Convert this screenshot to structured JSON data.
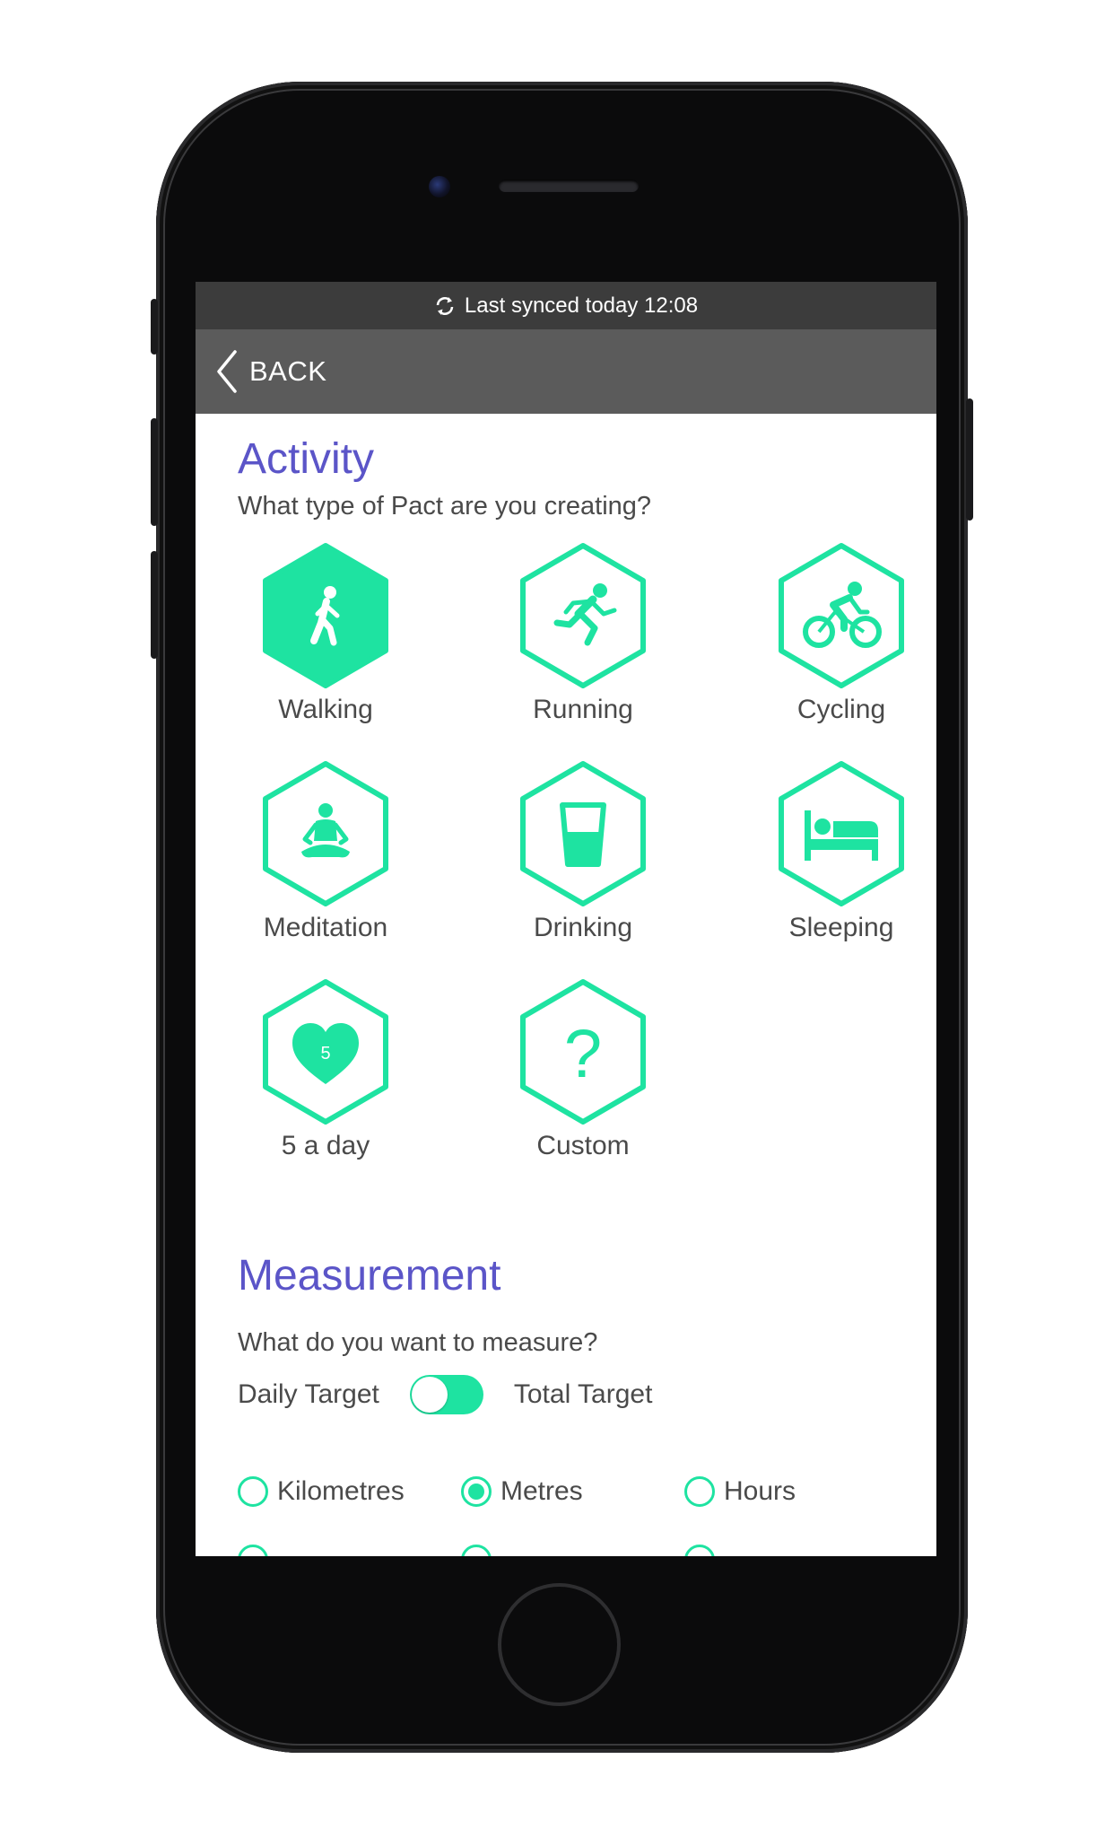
{
  "status": {
    "sync_text": "Last synced today 12:08",
    "sync_icon": "sync-icon"
  },
  "nav": {
    "back_label": "BACK",
    "back_icon": "chevron-left-icon"
  },
  "activity": {
    "title": "Activity",
    "subtitle": "What type of Pact are you creating?",
    "items": [
      {
        "label": "Walking",
        "icon": "walking-icon",
        "selected": true
      },
      {
        "label": "Running",
        "icon": "running-icon",
        "selected": false
      },
      {
        "label": "Cycling",
        "icon": "cycling-icon",
        "selected": false
      },
      {
        "label": "Meditation",
        "icon": "meditation-icon",
        "selected": false
      },
      {
        "label": "Drinking",
        "icon": "glass-icon",
        "selected": false
      },
      {
        "label": "Sleeping",
        "icon": "bed-icon",
        "selected": false
      },
      {
        "label": "5 a day",
        "icon": "heart-icon",
        "badge": "5",
        "selected": false
      },
      {
        "label": "Custom",
        "icon": "question-icon",
        "glyph": "?",
        "selected": false
      }
    ]
  },
  "measurement": {
    "title": "Measurement",
    "subtitle": "What do you want to measure?",
    "daily_label": "Daily Target",
    "total_label": "Total Target",
    "toggle_on": true,
    "options": [
      {
        "label": "Kilometres",
        "checked": false
      },
      {
        "label": "Metres",
        "checked": true
      },
      {
        "label": "Hours",
        "checked": false
      }
    ]
  },
  "colors": {
    "accent": "#1ee3a1",
    "heading": "#5b55c8",
    "text": "#4a4a4a",
    "sync_bar": "#3c3c3c",
    "nav_bar": "#5b5b5b"
  }
}
